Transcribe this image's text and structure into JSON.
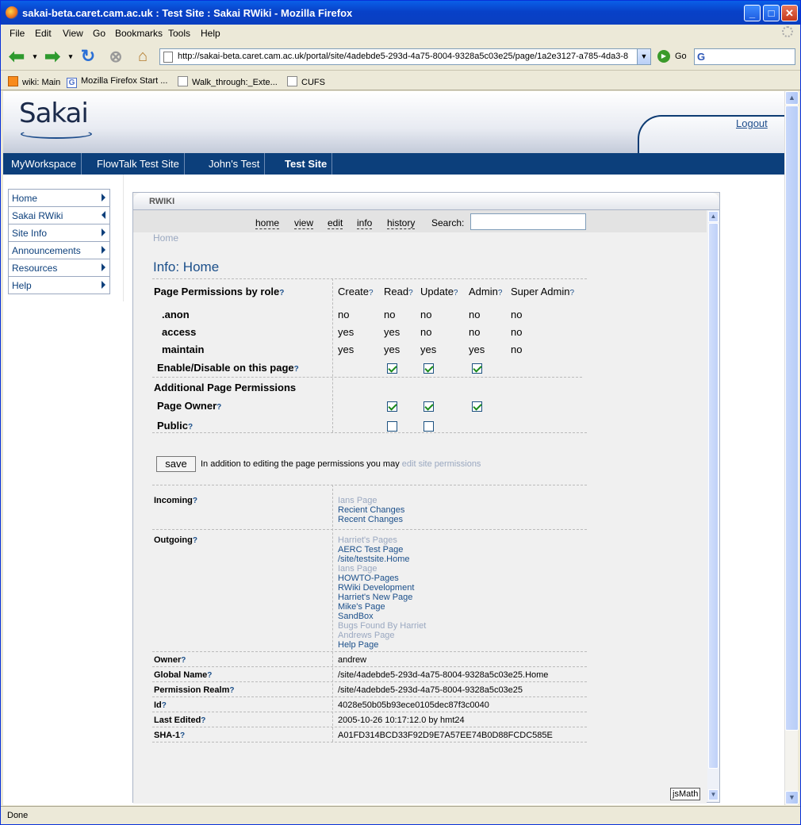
{
  "window": {
    "title": "sakai-beta.caret.cam.ac.uk : Test Site : Sakai RWiki - Mozilla Firefox"
  },
  "menu": [
    "File",
    "Edit",
    "View",
    "Go",
    "Bookmarks",
    "Tools",
    "Help"
  ],
  "toolbar": {
    "url": "http://sakai-beta.caret.cam.ac.uk/portal/site/4adebde5-293d-4a75-8004-9328a5c03e25/page/1a2e3127-a785-4da3-8",
    "go_label": "Go"
  },
  "bookmarks": [
    "wiki: Main",
    "Mozilla Firefox Start ...",
    "Walk_through:_Exte...",
    "CUFS"
  ],
  "status": "Done",
  "sakai": {
    "logo": "Sakai",
    "logout": "Logout",
    "sites": [
      "MyWorkspace",
      "FlowTalk Test Site",
      "John's Test",
      "Test Site"
    ],
    "nav": [
      "Home",
      "Sakai RWiki",
      "Site Info",
      "Announcements",
      "Resources",
      "Help"
    ]
  },
  "tool": {
    "title": "RWIKI",
    "links": [
      "home",
      "view",
      "edit",
      "info",
      "history"
    ],
    "search_label": "Search:",
    "breadcrumb": "Home",
    "heading": "Info: Home",
    "perm_title": "Page Permissions by role",
    "cols": [
      "Create",
      "Read",
      "Update",
      "Admin",
      "Super Admin"
    ],
    "roles": [
      {
        "name": ".anon",
        "vals": [
          "no",
          "no",
          "no",
          "no",
          "no"
        ]
      },
      {
        "name": "access",
        "vals": [
          "yes",
          "yes",
          "no",
          "no",
          "no"
        ]
      },
      {
        "name": "maintain",
        "vals": [
          "yes",
          "yes",
          "yes",
          "yes",
          "no"
        ]
      }
    ],
    "enable_label": "Enable/Disable on this page",
    "additional_title": "Additional Page Permissions",
    "owner_label": "Page Owner",
    "public_label": "Public",
    "save": "save",
    "save_note": "In addition to editing the page permissions you may",
    "save_link": "edit site permissions",
    "incoming_label": "Incoming",
    "incoming": [
      {
        "t": "Ians Page",
        "dim": true
      },
      {
        "t": "Recient Changes",
        "dim": false
      },
      {
        "t": "Recent Changes",
        "dim": false
      }
    ],
    "outgoing_label": "Outgoing",
    "outgoing": [
      {
        "t": "Harriet's Pages",
        "dim": true
      },
      {
        "t": "AERC Test Page",
        "dim": false
      },
      {
        "t": "/site/testsite.Home",
        "dim": false
      },
      {
        "t": "Ians Page",
        "dim": true
      },
      {
        "t": "HOWTO-Pages",
        "dim": false
      },
      {
        "t": "RWiki Development",
        "dim": false
      },
      {
        "t": "Harriet's New Page",
        "dim": false
      },
      {
        "t": "Mike's Page",
        "dim": false
      },
      {
        "t": "SandBox",
        "dim": false
      },
      {
        "t": "Bugs Found By Harriet",
        "dim": true
      },
      {
        "t": "Andrews Page",
        "dim": true
      },
      {
        "t": "Help Page",
        "dim": false
      }
    ],
    "details": [
      {
        "label": "Owner",
        "value": "andrew"
      },
      {
        "label": "Global Name",
        "value": "/site/4adebde5-293d-4a75-8004-9328a5c03e25.Home"
      },
      {
        "label": "Permission Realm",
        "value": "/site/4adebde5-293d-4a75-8004-9328a5c03e25"
      },
      {
        "label": "Id",
        "value": "4028e50b05b93ece0105dec87f3c0040"
      },
      {
        "label": "Last Edited",
        "value": "2005-10-26 10:17:12.0 by hmt24"
      },
      {
        "label": "SHA-1",
        "value": "A01FD314BCD33F92D9E7A57EE74B0D88FCDC585E"
      }
    ],
    "jsmath": "jsMath"
  }
}
